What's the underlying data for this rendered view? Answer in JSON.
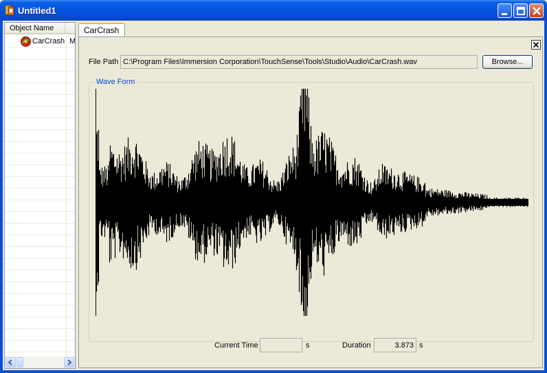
{
  "window": {
    "title": "Untitled1",
    "colors": {
      "titlebar": "#0553e0",
      "close": "#c4401c",
      "face": "#ece9d8"
    }
  },
  "object_list": {
    "column_header": "Object Name",
    "items": [
      {
        "name": "CarCrash",
        "col2": "M",
        "icon": "effect-icon"
      }
    ]
  },
  "tab": {
    "label": "CarCrash"
  },
  "file": {
    "label": "File Path",
    "path": "C:\\Program Files\\Immersion Corporation\\TouchSense\\Tools\\Studio\\Audio\\CarCrash.wav",
    "browse_label": "Browse..."
  },
  "waveform": {
    "legend": "Wave Form"
  },
  "timing": {
    "current_time_label": "Current Time",
    "current_time_value": "",
    "current_time_unit": "s",
    "duration_label": "Duration",
    "duration_value": "3.873",
    "duration_unit": "s"
  }
}
